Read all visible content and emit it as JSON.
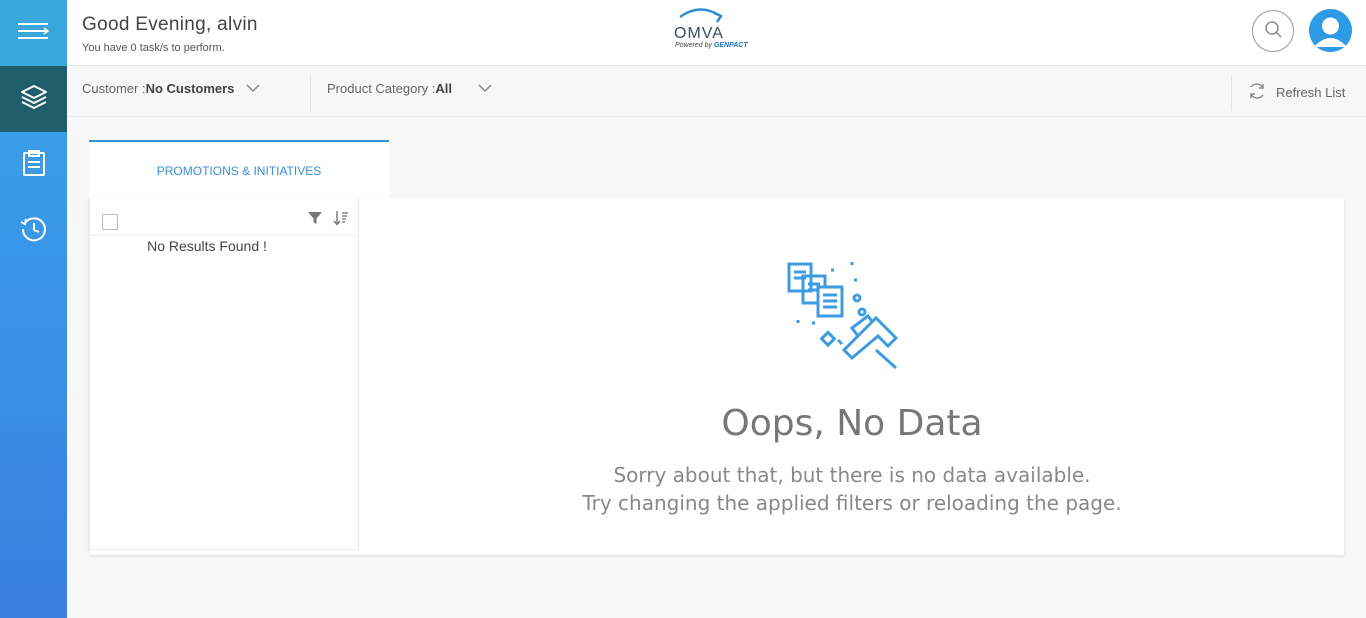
{
  "sidebar": {
    "items": [
      {
        "icon": "layers-icon"
      },
      {
        "icon": "clipboard-icon"
      },
      {
        "icon": "history-icon"
      }
    ]
  },
  "header": {
    "greeting": "Good Evening, alvin",
    "tasks": "You have 0 task/s to perform.",
    "logo_text": "OMVA",
    "logo_powered": "Powered by",
    "logo_brand": "GENPACT"
  },
  "filters": {
    "customer_label": "Customer : ",
    "customer_value": "No Customers",
    "category_label": "Product Category : ",
    "category_value": "All",
    "refresh_label": "Refresh List"
  },
  "tabs": [
    {
      "label": "PROMOTIONS & INITIATIVES"
    }
  ],
  "list": {
    "empty_text": "No Results Found !"
  },
  "empty_state": {
    "title": "Oops, No Data",
    "line1": "Sorry about that, but there is no data available.",
    "line2": "Try changing the applied filters or reloading the page."
  },
  "colors": {
    "accent": "#3b8fd4",
    "sidebar_active": "#1f5e6a"
  }
}
